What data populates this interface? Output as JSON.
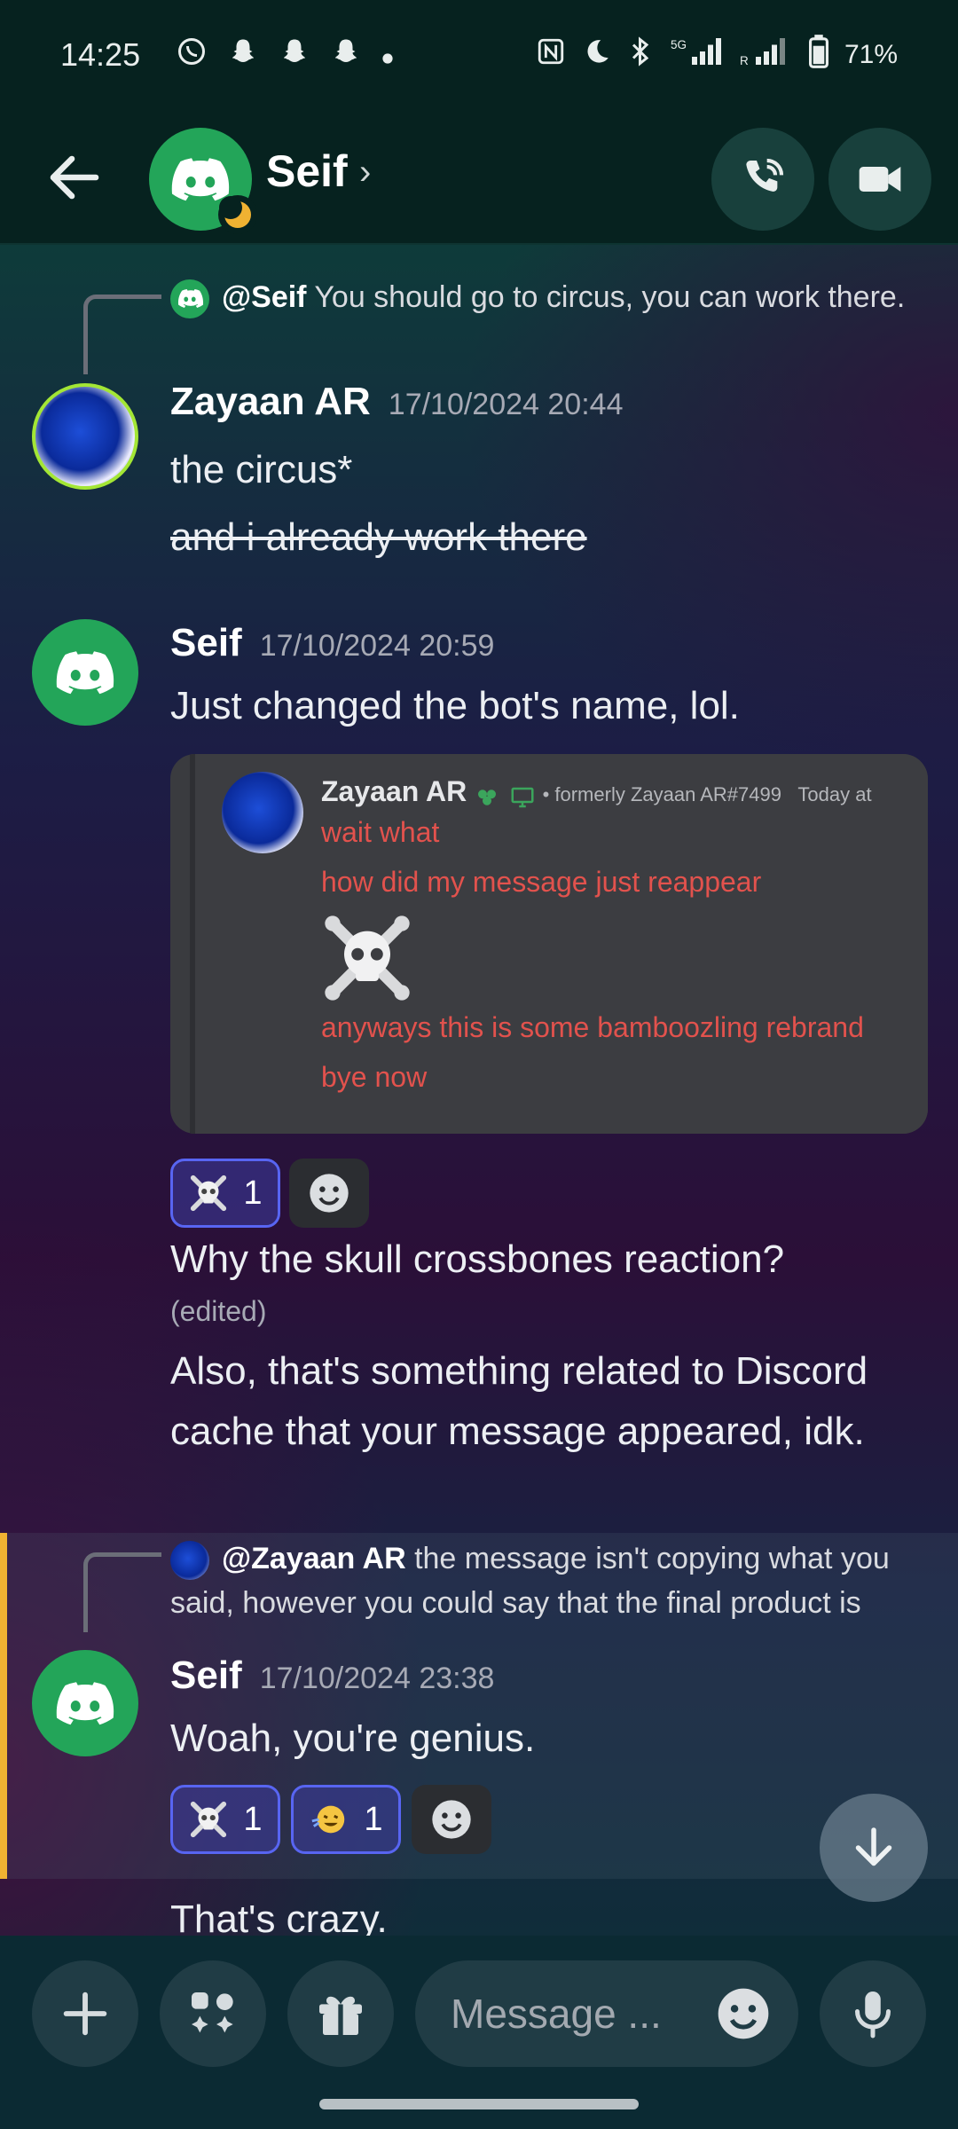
{
  "status_bar": {
    "time": "14:25",
    "battery": "71%",
    "left_icons": [
      "whatsapp-icon",
      "snapchat-icon",
      "snapchat-icon",
      "snapchat-icon",
      "dot-icon"
    ],
    "right_icons": [
      "nfc-icon",
      "moon-icon",
      "bluetooth-icon",
      "signal-5g-icon",
      "signal-icon",
      "battery-icon"
    ]
  },
  "header": {
    "name": "Seif",
    "chevron": "›"
  },
  "messages": {
    "m1": {
      "reply_name": "@Seif",
      "reply_text": "You should go to circus, you can work there.",
      "author": "Zayaan AR",
      "timestamp": "17/10/2024 20:44",
      "line1": "the circus*",
      "line2": "and i already work there"
    },
    "m2": {
      "author": "Seif",
      "timestamp": "17/10/2024 20:59",
      "text": "Just changed the bot's name, lol."
    },
    "embed": {
      "author": "Zayaan AR",
      "meta": "• formerly Zayaan AR#7499",
      "time": "Today at",
      "line1": "wait what",
      "line2": "how did my message just reappear",
      "line3": "anyways this is some bamboozling rebrand",
      "line4": "bye now"
    },
    "reactions1": {
      "skull_count": "1"
    },
    "m3": {
      "text1": "Why the skull crossbones reaction?",
      "edited": "(edited)",
      "text2": "Also, that's something related to Discord cache that your message appeared, idk."
    },
    "m4": {
      "reply_name": "@Zayaan AR",
      "reply_text": "the message isn't copying what you said, however you could say that the final product is",
      "author": "Seif",
      "timestamp": "17/10/2024 23:38",
      "text": "Woah, you're genius."
    },
    "reactions2": {
      "skull_count": "1",
      "emoji_count": "1"
    },
    "m5": {
      "text": "That's crazy."
    }
  },
  "input": {
    "placeholder": "Message ..."
  },
  "colors": {
    "discord_green": "#23a559",
    "blurple": "#5865f2",
    "mention_yellow": "#f0b232",
    "embed_red": "#e2524d"
  }
}
